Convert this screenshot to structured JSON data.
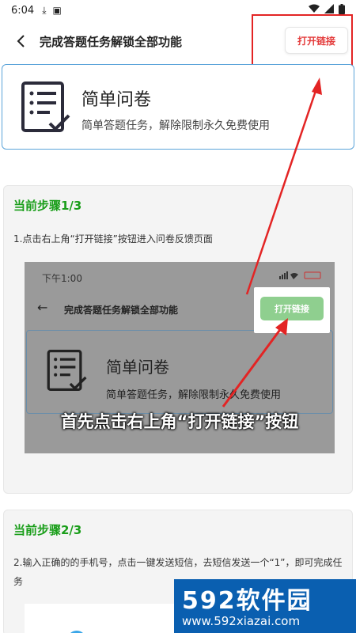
{
  "status_bar": {
    "time": "6:04",
    "battery_level": 1.0
  },
  "header": {
    "title": "完成答题任务解锁全部功能",
    "open_link_label": "打开链接"
  },
  "intro": {
    "title": "简单问卷",
    "description": "简单答题任务，解除限制永久免费使用"
  },
  "steps": [
    {
      "title": "当前步骤1/3",
      "description": "1.点击右上角“打开链接”按钮进入问卷反馈页面",
      "screenshot": {
        "time": "下午1:00",
        "title": "完成答题任务解锁全部功能",
        "button_label": "打开链接",
        "card_title": "简单问卷",
        "card_desc": "简单答题任务，解除限制永久免费使用",
        "caption": "首先点击右上角“打开链接”按钮"
      }
    },
    {
      "title": "当前步骤2/3",
      "description": "2.输入正确的的手机号，点击一键发送短信，去短信发送一个“1”，即可完成任务"
    }
  ],
  "watermark": {
    "brand": "592软件园",
    "url": "www.592xiazai.com"
  },
  "colors": {
    "accent_red": "#e43b3b",
    "step_green": "#1a9e1a",
    "card_border": "#5aa3d9",
    "watermark_blue": "#0a5fb0"
  }
}
